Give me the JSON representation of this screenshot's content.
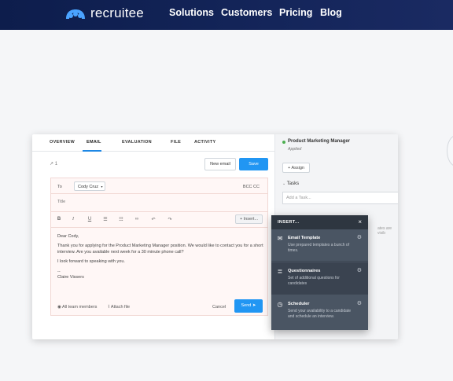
{
  "nav": {
    "logo_text": "recruitee",
    "links": [
      "Solutions",
      "Customers",
      "Pricing",
      "Blog"
    ]
  },
  "email_panel": {
    "tabs": [
      "OVERVIEW",
      "EMAIL",
      "EVALUATION",
      "FILE",
      "ACTIVITY"
    ],
    "active_tab": "EMAIL",
    "counter": "1",
    "new_email_label": "New email",
    "save_label": "Save",
    "to_label": "To",
    "to_value": "Cody Cruz",
    "bcc_cc_label": "BCC CC",
    "title_placeholder": "Title",
    "toolbar_insert_label": "+ Insert...",
    "body": {
      "greeting": "Dear Cody,",
      "paragraph1": "Thank you for applying for the Product Marketing Manager position. We would like to contact you for a short interview. Are you available next week for a 30 minute phone call?",
      "paragraph2": "I look forward to speaking with you.",
      "separator": "--",
      "signature": "Claire Vissers"
    },
    "visibility_label": "All team members",
    "attach_label": "Attach file",
    "cancel_label": "Cancel",
    "send_label": "Send"
  },
  "sidebar": {
    "candidate_title": "Product Marketing Manager",
    "candidate_status": "Applied",
    "assign_label": "+ Assign",
    "tasks_label": "Tasks",
    "task_placeholder": "Add a Task...",
    "partial_text": "ates are visib"
  },
  "insert_menu": {
    "title": "INSERT...",
    "items": [
      {
        "name": "Email Template",
        "description": "Use prepared templates a bunch of times."
      },
      {
        "name": "Questionnaires",
        "description": "Set of additional questions for candidates"
      },
      {
        "name": "Scheduler",
        "description": "Send your availability to a candidate and schedule an interview."
      }
    ]
  },
  "colors": {
    "nav_bg": "#0d1d4c",
    "primary_button": "#2196f3",
    "menu_bg": "#4a5563"
  }
}
